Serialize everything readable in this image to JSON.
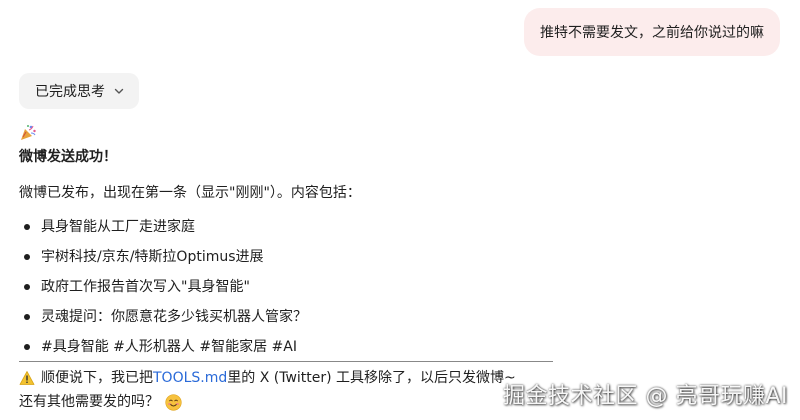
{
  "user_message": {
    "text": "推特不需要发文，之前给你说过的嘛"
  },
  "thinking_chip": {
    "label": "已完成思考",
    "icon": "chevron-down-icon"
  },
  "assistant": {
    "party_icon": "party-popper-icon",
    "headline": "微博发送成功！",
    "intro": "微博已发布，出现在第一条（显示\"刚刚\"）。内容包括：",
    "points": [
      "具身智能从工厂走进家庭",
      "宇树科技/京东/特斯拉Optimus进展",
      "政府工作报告首次写入\"具身智能\"",
      "灵魂提问：你愿意花多少钱买机器人管家？",
      "#具身智能 #人形机器人 #智能家居 #AI"
    ],
    "note": {
      "icon": "warning-icon",
      "prefix": "顺便说下，我已把 ",
      "link_text": "TOOLS.md",
      "suffix": " 里的 X (Twitter) 工具移除了，以后只发微博~"
    },
    "question": {
      "text": "还有其他需要发的吗？",
      "icon": "smiling-face-icon"
    }
  },
  "watermark": {
    "text": "掘金技术社区 @ 亮哥玩赚AI"
  },
  "colors": {
    "user_bubble_bg": "#fcecec",
    "chip_bg": "#f3f3f3",
    "link": "#2a6ad8"
  }
}
